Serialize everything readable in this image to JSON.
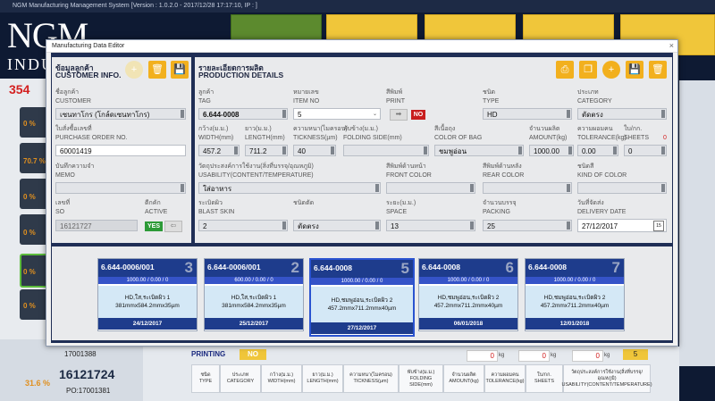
{
  "app": {
    "title": "NGM Manufacturing Management System [Version : 1.0.2.0 - 2017/12/28 17:17:10, IP : ]",
    "logo_big": "NGM",
    "logo_small": "INDU",
    "red_count": "354",
    "left_pcts": [
      "0 %",
      "70.7 %",
      "0 %",
      "0 %",
      "0 %",
      "0 %",
      "0 %"
    ],
    "bottom_left": {
      "code1": "17001388",
      "code2": "16121724",
      "pct": "31.6 %",
      "code3": "PO:17001381"
    },
    "printing_label": "PRINTING",
    "printing_value": "NO",
    "kg_values": [
      "0",
      "0",
      "0"
    ],
    "kg_unit": "kg",
    "yellow_value": "5",
    "table_headers": [
      {
        "th": "ชนิด",
        "en": "TYPE"
      },
      {
        "th": "ประเภท",
        "en": "CATEGORY"
      },
      {
        "th": "กว้าง(ม.ม.)",
        "en": "WIDTH(mm)"
      },
      {
        "th": "ยาว(ม.ม.)",
        "en": "LENGTH(mm)"
      },
      {
        "th": "ความหนา(ไมครอน)",
        "en": "TICKNESS(µm)"
      },
      {
        "th": "พับข้าง(ม.ม.)",
        "en": "FOLDING SIDE(mm)"
      },
      {
        "th": "จำนวนผลิต",
        "en": "AMOUNT(kg)"
      },
      {
        "th": "ความผอมคน",
        "en": "TOLERANCE(kg)"
      },
      {
        "th": "ใบ/กก.",
        "en": "SHEETS"
      },
      {
        "th": "วัตถุประสงค์การใช้งาน(สิ่งที่บรรจุ/อุณหภูมิ)",
        "en": "USABILITY(CONTENT/TEMPERATURE)"
      }
    ]
  },
  "dialog": {
    "title": "Manufacturing Data Editor",
    "close": "×",
    "customer": {
      "title_th": "ข้อมูลลูกค้า",
      "title_en": "CUSTOMER INFO.",
      "customer_label_th": "ชื่อลูกค้า",
      "customer_label_en": "CUSTOMER",
      "customer_value": "เซนทาโกร (โกล์ดเซนทาโกร)",
      "po_label_th": "ใบสั่งซื้อเลขที่",
      "po_label_en": "PURCHASE ORDER NO.",
      "po_value": "60001419",
      "memo_label_th": "บันทึกความจำ",
      "memo_label_en": "MEMO",
      "memo_value": "",
      "so_label_th": "เลขที่",
      "so_label_en": "SO",
      "so_value": "16121727",
      "active_label_th": "ตีกคัก",
      "active_label_en": "ACTIVE",
      "active_value": "YES",
      "active_arrow": "⇦"
    },
    "production": {
      "title_th": "รายละเอียดการผลิต",
      "title_en": "PRODUCTION DETAILS",
      "tag": {
        "th": "ลูกค้า",
        "en": "TAG",
        "value": "6.644-0008"
      },
      "item_no": {
        "th": "หมายเลข",
        "en": "ITEM NO",
        "value": "5"
      },
      "print": {
        "th": "สีพิมพ์",
        "en": "PRINT",
        "value": "NO",
        "arrow": "➡"
      },
      "type": {
        "th": "ชนิด",
        "en": "TYPE",
        "value": "HD"
      },
      "category": {
        "th": "ประเภท",
        "en": "CATEGORY",
        "value": "ตัดตรง"
      },
      "width": {
        "th": "กว้าง(ม.ม.)",
        "en": "WIDTH(mm)",
        "value": "457.2"
      },
      "length": {
        "th": "ยาว(ม.ม.)",
        "en": "LENGTH(mm)",
        "value": "711.2"
      },
      "tickness": {
        "th": "ความหนา(ไมครอน)",
        "en": "TICKNESS(µm)",
        "value": "40"
      },
      "folding": {
        "th": "พับข้าง(ม.ม.)",
        "en": "FOLDING SIDE(mm)",
        "value": ""
      },
      "color_of_bag": {
        "th": "สีเนื้อถุง",
        "en": "COLOR OF BAG",
        "value": "ชมพูอ่อน"
      },
      "amount": {
        "th": "จำนวนผลิต",
        "en": "AMOUNT(kg)",
        "value": "1000.00"
      },
      "tolerance": {
        "th": "ความผอมคน",
        "en": "TOLERANCE(kg)",
        "value": "0.00"
      },
      "sheets": {
        "th": "ใบ/กก.",
        "en": "SHEETS",
        "value": "0",
        "red": "0"
      },
      "usability": {
        "th": "วัตถุประสงค์การใช้งาน(สิ่งที่บรรจุ/อุณหภูมิ)",
        "en": "USABILITY(CONTENT/TEMPERATURE)",
        "value": "ใส่อาหาร"
      },
      "front_color": {
        "th": "สีพิมพ์ด้านหน้า",
        "en": "FRONT COLOR",
        "value": ""
      },
      "rear_color": {
        "th": "สีพิมพ์ด้านหลัง",
        "en": "REAR COLOR",
        "value": ""
      },
      "kind_of_color": {
        "th": "ชนิดสี",
        "en": "KIND OF COLOR",
        "value": ""
      },
      "blast_skin": {
        "th": "ระเบิดผิว",
        "en": "BLAST SKIN",
        "value": "2"
      },
      "cut_type": {
        "th": "ชนิดตัด",
        "en": "",
        "value": "ตัดตรง"
      },
      "space": {
        "th": "ระยะ(ม.ม.)",
        "en": "SPACE",
        "value": "13"
      },
      "packing": {
        "th": "จำนวนบรรจุ",
        "en": "PACKING",
        "value": "25"
      },
      "delivery": {
        "th": "วันที่จัดส่ง",
        "en": "DELIVERY DATE",
        "value": "27/12/2017",
        "icon": "15"
      }
    },
    "cards": [
      {
        "code": "6.644-0006/001",
        "num": "3",
        "amt": "1000.00 / 0.00 / 0",
        "line1": "HD,ใส,ระเบิดผิว 1",
        "line2": "381mmx584.2mmx35µm",
        "date": "24/12/2017"
      },
      {
        "code": "6.644-0006/001",
        "num": "2",
        "amt": "600.00 / 0.00 / 0",
        "line1": "HD,ใส,ระเบิดผิว 1",
        "line2": "381mmx584.2mmx35µm",
        "date": "25/12/2017"
      },
      {
        "code": "6.644-0008",
        "num": "5",
        "amt": "1000.00 / 0.00 / 0",
        "line1": "HD,ชมพูอ่อน,ระเบิดผิว 2",
        "line2": "457.2mmx711.2mmx40µm",
        "date": "27/12/2017"
      },
      {
        "code": "6.644-0008",
        "num": "6",
        "amt": "1000.00 / 0.00 / 0",
        "line1": "HD,ชมพูอ่อน,ระเบิดผิว 2",
        "line2": "457.2mmx711.2mmx40µm",
        "date": "06/01/2018"
      },
      {
        "code": "6.644-0008",
        "num": "7",
        "amt": "1000.00 / 0.00 / 0",
        "line1": "HD,ชมพูอ่อน,ระเบิดผิว 2",
        "line2": "457.2mmx711.2mmx40µm",
        "date": "12/01/2018"
      }
    ]
  }
}
